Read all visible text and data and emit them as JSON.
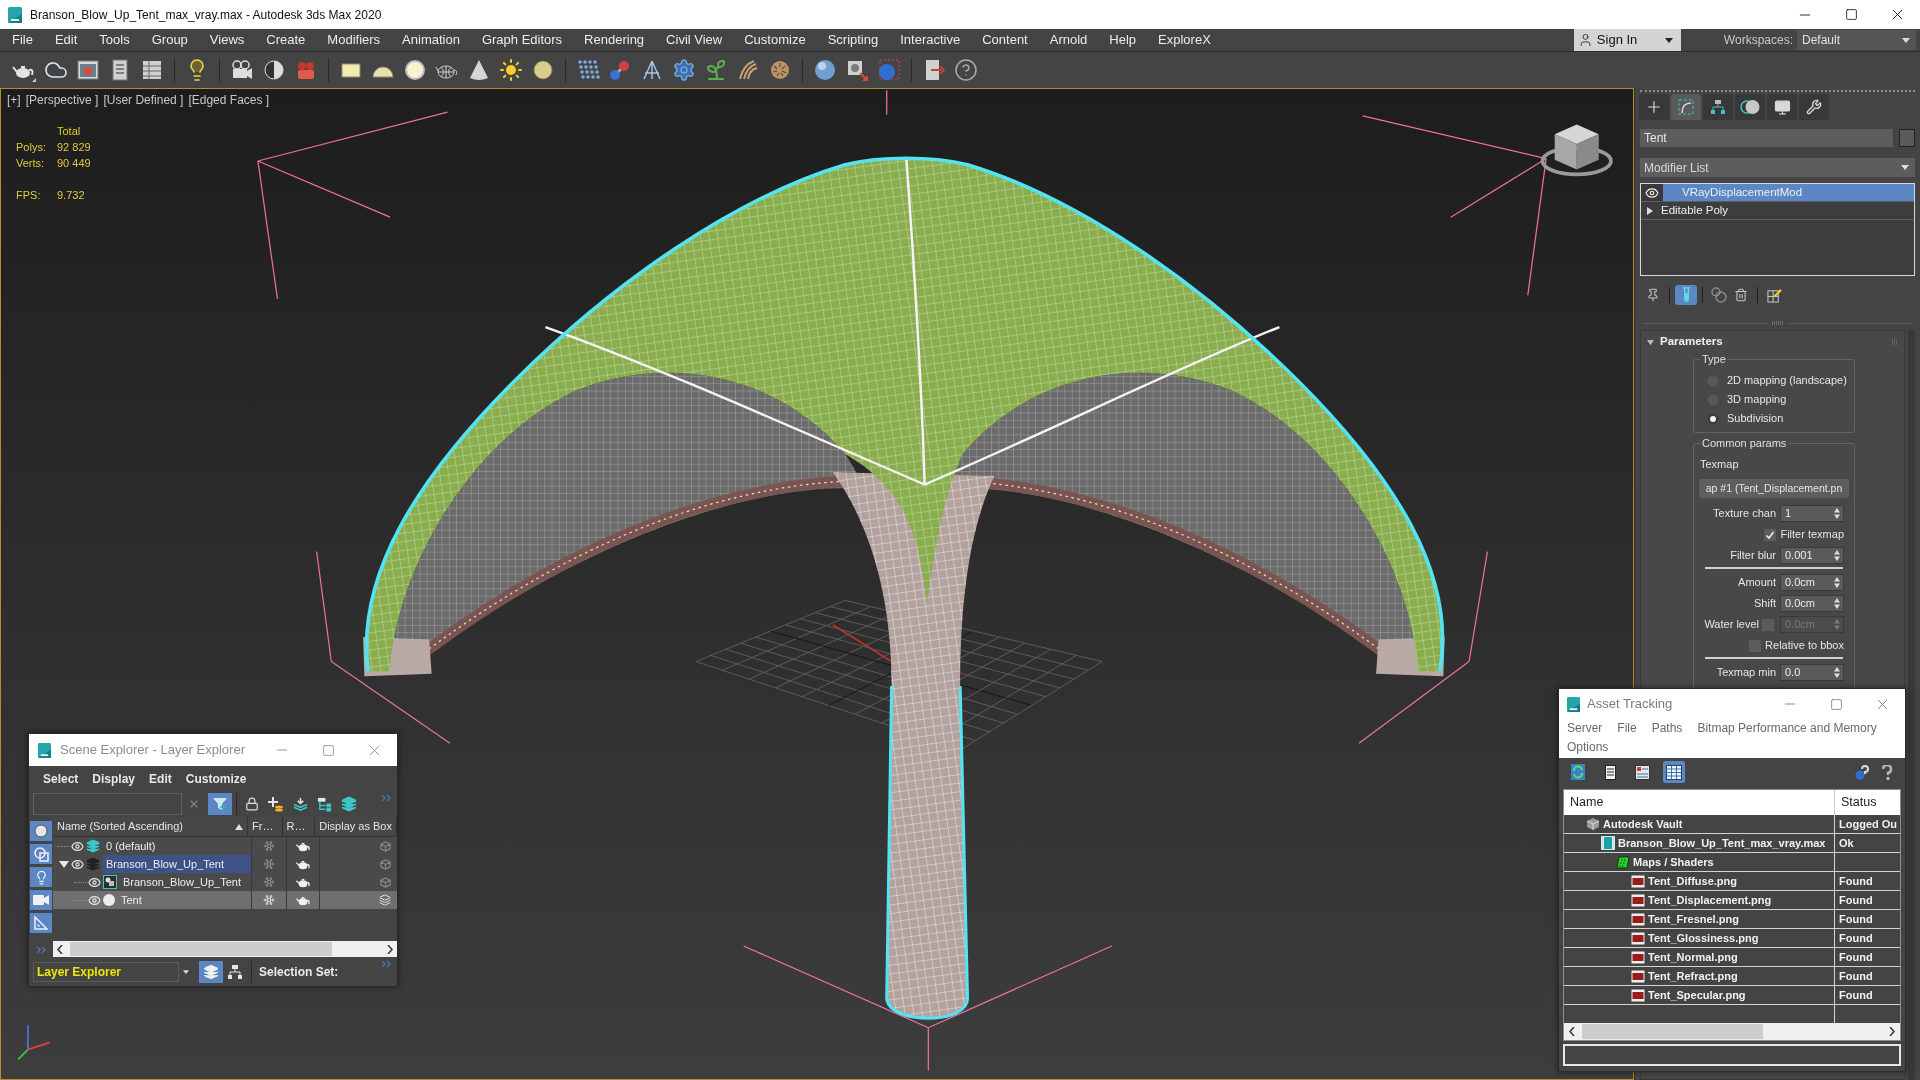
{
  "window": {
    "title": "Branson_Blow_Up_Tent_max_vray.max - Autodesk 3ds Max 2020"
  },
  "menu": [
    "File",
    "Edit",
    "Tools",
    "Group",
    "Views",
    "Create",
    "Modifiers",
    "Animation",
    "Graph Editors",
    "Rendering",
    "Civil View",
    "Customize",
    "Scripting",
    "Interactive",
    "Content",
    "Arnold",
    "Help",
    "ExploreX"
  ],
  "account": {
    "label": "Sign In"
  },
  "workspaces": {
    "label": "Workspaces:",
    "value": "Default"
  },
  "viewport": {
    "labels": [
      "[+]",
      "[Perspective ]",
      "[User Defined ]",
      "[Edged Faces ]"
    ],
    "stats": {
      "header": "Total",
      "rows": [
        {
          "label": "Polys:",
          "value": "92 829"
        },
        {
          "label": "Verts:",
          "value": "90 449"
        }
      ],
      "fps": {
        "label": "FPS:",
        "value": "9.732"
      }
    }
  },
  "command_panel": {
    "tabs": [
      {
        "selected": false
      },
      {
        "selected": true
      },
      {
        "selected": false
      },
      {
        "selected": false
      },
      {
        "selected": false
      },
      {
        "selected": false
      }
    ],
    "object_name": "Tent",
    "modifier_list": "Modifier List",
    "stack": [
      {
        "label": "VRayDisplacementMod",
        "kind": "modifier",
        "selected": true
      },
      {
        "label": "Editable Poly",
        "kind": "object",
        "selected": false
      }
    ],
    "stack_tools": [
      {
        "on": false
      },
      {
        "on": true
      },
      {
        "on": false
      },
      {
        "on": false
      },
      {
        "on": false
      }
    ],
    "rollout": {
      "title": "Parameters",
      "expanded": true,
      "type_group": {
        "title": "Type",
        "options": [
          {
            "label": "2D mapping (landscape)",
            "selected": false
          },
          {
            "label": "3D mapping",
            "selected": false
          },
          {
            "label": "Subdivision",
            "selected": true
          }
        ]
      },
      "common_group": {
        "title": "Common params",
        "texmap_label": "Texmap",
        "texmap": "ap #1 (Tent_Displacement.pn",
        "sections": [
          [
            {
              "kind": "spinner",
              "label": "Texture chan",
              "value": "1",
              "disabled": false
            },
            {
              "kind": "checkbox",
              "label": "Filter texmap",
              "checked": true,
              "disabled": false
            },
            {
              "kind": "spinner",
              "label": "Filter blur",
              "value": "0.001",
              "disabled": false
            }
          ],
          [
            {
              "kind": "spinner",
              "label": "Amount",
              "value": "0.0cm",
              "disabled": false
            },
            {
              "kind": "spinner",
              "label": "Shift",
              "value": "0.0cm",
              "disabled": false
            },
            {
              "kind": "check_spinner",
              "label": "Water level",
              "checked": false,
              "value": "0.0cm",
              "disabled": true
            },
            {
              "kind": "checkbox",
              "label": "Relative to bbox",
              "checked": false,
              "disabled": false
            }
          ],
          [
            {
              "kind": "spinner",
              "label": "Texmap min",
              "value": "0.0",
              "disabled": false
            }
          ]
        ]
      }
    }
  },
  "scene_explorer": {
    "title": "Scene Explorer - Layer Explorer",
    "menu": [
      "Select",
      "Display",
      "Edit",
      "Customize"
    ],
    "filter_on": true,
    "type_filters": [
      {
        "on": true
      },
      {
        "on": true
      },
      {
        "on": true
      },
      {
        "on": true
      },
      {
        "on": true
      }
    ],
    "columns": [
      {
        "label": "Name (Sorted Ascending)",
        "sorted": true
      },
      {
        "label": "Fr…",
        "sorted": false
      },
      {
        "label": "R…",
        "sorted": false
      },
      {
        "label": "Display as Box",
        "sorted": false
      }
    ],
    "tree": [
      {
        "name": "0 (default)",
        "kind": "layer",
        "current": true,
        "selected": false,
        "highlighted": false
      },
      {
        "name": "Branson_Blow_Up_Tent",
        "kind": "layer",
        "current": false,
        "selected": true,
        "highlighted": false,
        "expanded": true,
        "children": [
          {
            "name": "Branson_Blow_Up_Tent",
            "kind": "group",
            "selected": false,
            "highlighted": false
          },
          {
            "name": "Tent",
            "kind": "object",
            "selected": false,
            "highlighted": true
          }
        ]
      }
    ],
    "explorer_mode": "Layer Explorer",
    "layer_mode_on": true,
    "selection_set_label": "Selection Set:"
  },
  "asset_tracking": {
    "title": "Asset Tracking",
    "menu": [
      "Server",
      "File",
      "Paths",
      "Bitmap Performance and Memory",
      "Options"
    ],
    "tools": [
      {
        "on": false
      },
      {
        "on": false
      },
      {
        "on": false
      },
      {
        "on": true
      }
    ],
    "columns": [
      "Name",
      "Status"
    ],
    "tree": [
      {
        "name": "Autodesk Vault",
        "kind": "vault",
        "status": "Logged Ou",
        "children": [
          {
            "name": "Branson_Blow_Up_Tent_max_vray.max",
            "kind": "scene",
            "status": "Ok",
            "children": [
              {
                "name": "Maps / Shaders",
                "kind": "folder",
                "children": [
                  {
                    "name": "Tent_Diffuse.png",
                    "kind": "image",
                    "status": "Found"
                  },
                  {
                    "name": "Tent_Displacement.png",
                    "kind": "image",
                    "status": "Found"
                  },
                  {
                    "name": "Tent_Fresnel.png",
                    "kind": "image",
                    "status": "Found"
                  },
                  {
                    "name": "Tent_Glossiness.png",
                    "kind": "image",
                    "status": "Found"
                  },
                  {
                    "name": "Tent_Normal.png",
                    "kind": "image",
                    "status": "Found"
                  },
                  {
                    "name": "Tent_Refract.png",
                    "kind": "image",
                    "status": "Found"
                  },
                  {
                    "name": "Tent_Specular.png",
                    "kind": "image",
                    "status": "Found"
                  }
                ]
              }
            ]
          }
        ]
      }
    ]
  }
}
